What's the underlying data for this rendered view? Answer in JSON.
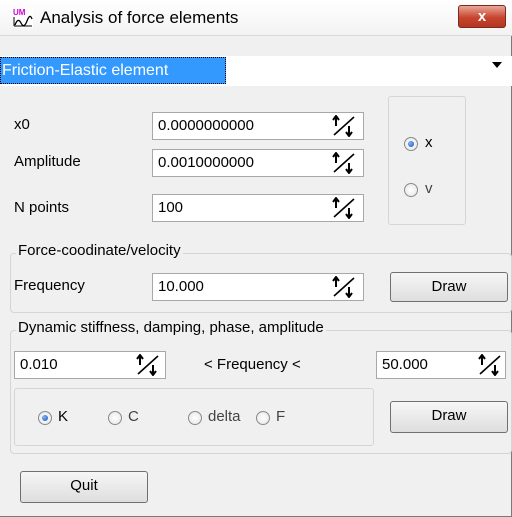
{
  "window": {
    "title": "Analysis of force elements",
    "close_label": "x"
  },
  "selector": {
    "value": "Friction-Elastic element"
  },
  "params": {
    "x0_label": "x0",
    "x0_value": "0.0000000000",
    "amplitude_label": "Amplitude",
    "amplitude_value": "0.0010000000",
    "npoints_label": "N points",
    "npoints_value": "100",
    "mode_x_label": "x",
    "mode_v_label": "v"
  },
  "force_group": {
    "title": "Force-coodinate/velocity",
    "frequency_label": "Frequency",
    "frequency_value": "10.000",
    "draw_label": "Draw"
  },
  "dynamic_group": {
    "title": "Dynamic stiffness, damping, phase, amplitude",
    "min_value": "0.010",
    "range_label": "< Frequency <",
    "max_value": "50.000",
    "opt_k": "K",
    "opt_c": "C",
    "opt_delta": "delta",
    "opt_f": "F",
    "draw_label": "Draw"
  },
  "quit_label": "Quit",
  "icons": {
    "app": "app-icon",
    "spin": "spinner-icon",
    "close": "close-icon"
  }
}
